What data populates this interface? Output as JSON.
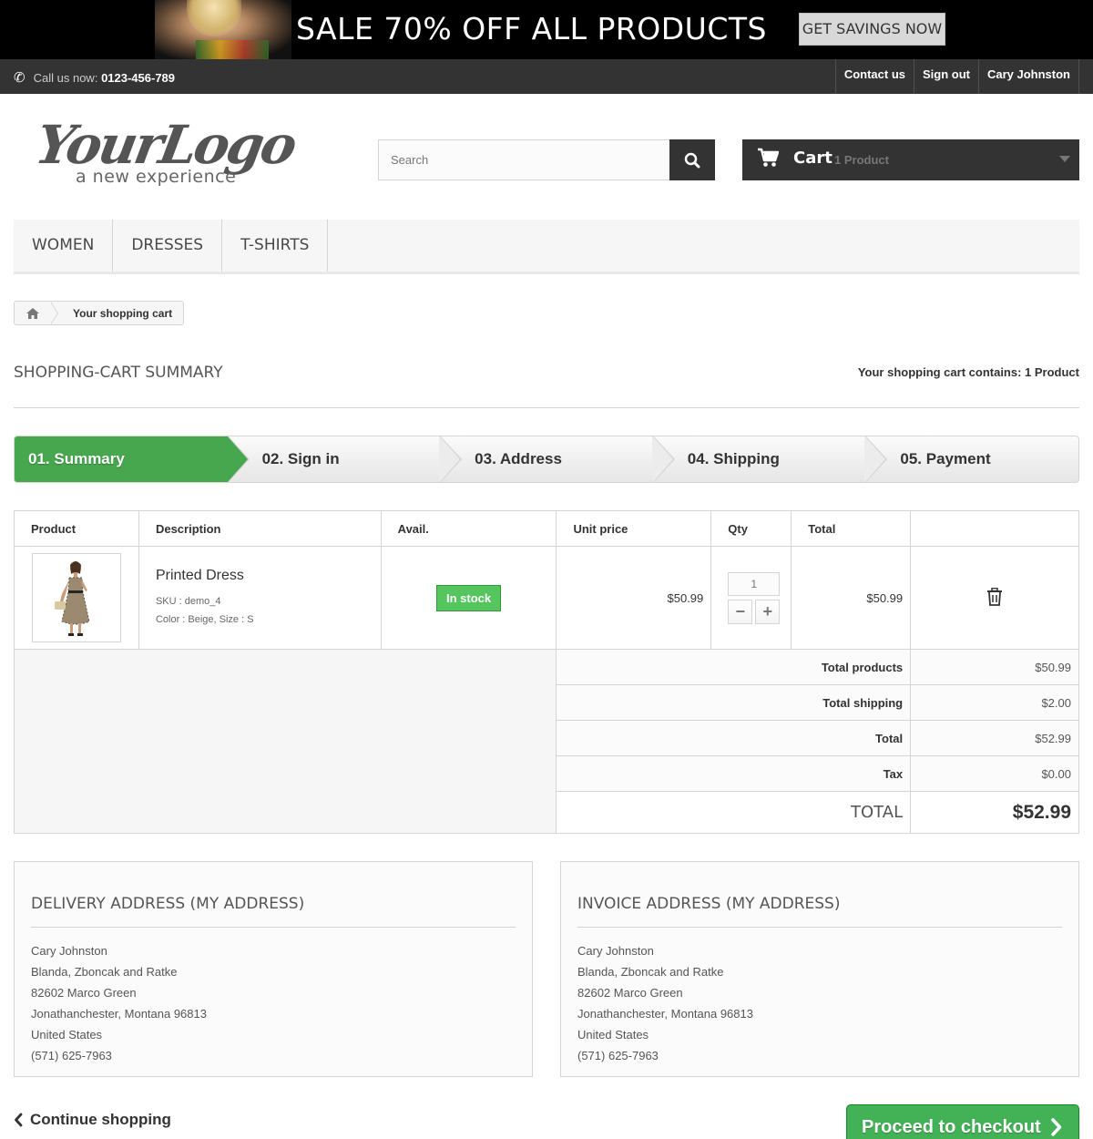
{
  "promo": {
    "text": "SALE 70% OFF ALL PRODUCTS",
    "button_label": "GET SAVINGS NOW"
  },
  "topbar": {
    "call_label": "Call us now:",
    "phone": "0123-456-789",
    "links": [
      "Contact us",
      "Sign out",
      "Cary Johnston"
    ]
  },
  "logo": {
    "script": "YourLogo",
    "tagline": "a new experience"
  },
  "search": {
    "placeholder": "Search",
    "icon": "search-icon"
  },
  "cart": {
    "label": "Cart",
    "count_text": "1 Product",
    "icon": "shopping-cart-icon"
  },
  "menu": {
    "items": [
      "WOMEN",
      "DRESSES",
      "T-SHIRTS"
    ]
  },
  "breadcrumb": {
    "home_icon": "home-icon",
    "current": "Your shopping cart"
  },
  "page": {
    "heading": "SHOPPING-CART SUMMARY",
    "contains_text": "Your shopping cart contains: 1 Product"
  },
  "steps": [
    {
      "label": "01. Summary",
      "active": true
    },
    {
      "label": "02. Sign in",
      "active": false
    },
    {
      "label": "03. Address",
      "active": false
    },
    {
      "label": "04. Shipping",
      "active": false
    },
    {
      "label": "05. Payment",
      "active": false
    }
  ],
  "table": {
    "headers": [
      "Product",
      "Description",
      "Avail.",
      "Unit price",
      "Qty",
      "Total"
    ],
    "rows": [
      {
        "name": "Printed Dress",
        "sku": "SKU : demo_4",
        "attributes": "Color : Beige, Size : S",
        "availability": "In stock",
        "unit_price": "$50.99",
        "qty": "1",
        "total": "$50.99",
        "delete_icon": "trash-icon"
      }
    ]
  },
  "totals": {
    "products_label": "Total products",
    "products_value": "$50.99",
    "shipping_label": "Total shipping",
    "shipping_value": "$2.00",
    "total_label": "Total",
    "total_value": "$52.99",
    "tax_label": "Tax",
    "tax_value": "$0.00",
    "grand_label": "TOTAL",
    "grand_value": "$52.99"
  },
  "delivery": {
    "title": "DELIVERY ADDRESS (MY ADDRESS)",
    "lines": [
      "Cary Johnston",
      "Blanda, Zboncak and Ratke",
      "82602 Marco Green",
      "Jonathanchester, Montana 96813",
      "United States",
      "(571) 625-7963"
    ]
  },
  "invoice": {
    "title": "INVOICE ADDRESS (MY ADDRESS)",
    "lines": [
      "Cary Johnston",
      "Blanda, Zboncak and Ratke",
      "82602 Marco Green",
      "Jonathanchester, Montana 96813",
      "United States",
      "(571) 625-7963"
    ]
  },
  "actions": {
    "continue_label": "Continue shopping",
    "proceed_label": "Proceed to checkout"
  },
  "colors": {
    "accent_green": "#46a74e",
    "badge_green": "#55c65e",
    "dark_bar": "#333333"
  }
}
